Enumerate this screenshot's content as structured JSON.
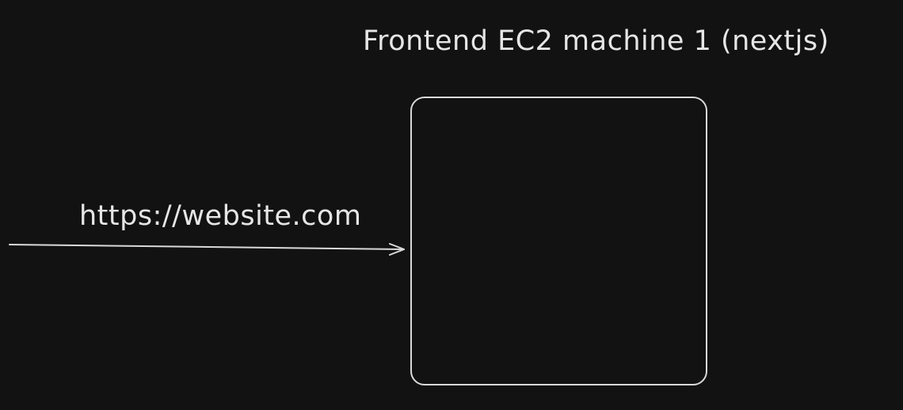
{
  "diagram": {
    "machine": {
      "title": "Frontend EC2 machine 1 (nextjs)"
    },
    "request": {
      "url": "https://website.com"
    }
  },
  "colors": {
    "background": "#121212",
    "stroke": "#d9d9d9",
    "text": "#e6e6e6"
  }
}
